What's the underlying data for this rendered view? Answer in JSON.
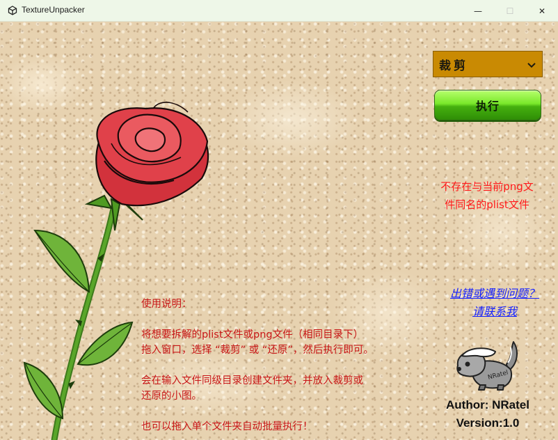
{
  "window": {
    "title": "TextureUnpacker",
    "minimize_glyph": "—",
    "maximize_glyph": "☐",
    "close_glyph": "✕"
  },
  "mode_select": {
    "selected": "裁剪"
  },
  "execute_button": {
    "label": "执行"
  },
  "status": {
    "line1": "不存在与当前png文",
    "line2": "件同名的plist文件"
  },
  "contact": {
    "line1": "出错或遇到问题？",
    "line2": "请联系我"
  },
  "author": {
    "author_line": "Author: NRatel",
    "version_line": "Version:1.0",
    "mascot_text": "NRatel"
  },
  "instructions": {
    "heading": "使用说明：",
    "step1_line1": "将想要拆解的plist文件或png文件（相同目录下）",
    "step1_line2": "拖入窗口，选择 “裁剪” 或 “还原”，然后执行即可。",
    "step2_line1": "会在输入文件同级目录创建文件夹，并放入裁剪或",
    "step2_line2": "还原的小图。",
    "step3": "也可以拖入单个文件夹自动批量执行！"
  },
  "colors": {
    "select_bg": "#c98a03",
    "button_green": "#45b00f",
    "status_red": "#ff1a1a",
    "link_blue": "#1622ff",
    "instruction_red": "#c81616"
  },
  "icons": {
    "app": "unity-logo-icon",
    "select": "chevron-down-icon"
  }
}
